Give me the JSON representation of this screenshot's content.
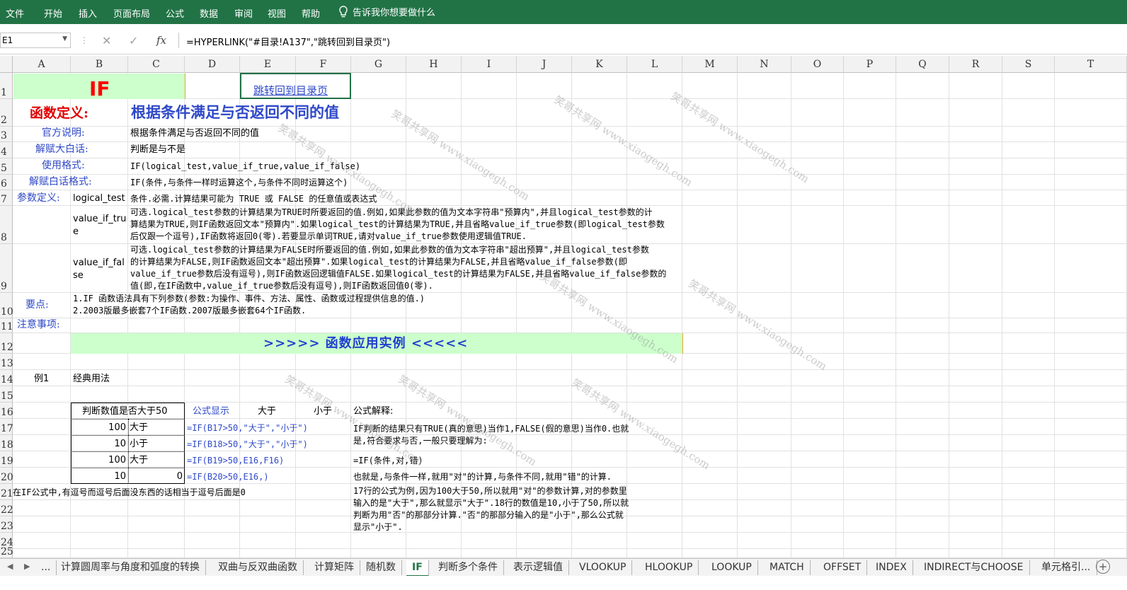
{
  "ribbon": {
    "tabs": [
      "文件",
      "开始",
      "插入",
      "页面布局",
      "公式",
      "数据",
      "审阅",
      "视图",
      "帮助"
    ],
    "tell_me": "告诉我你想要做什么"
  },
  "formula_bar": {
    "name_box": "E1",
    "formula": "=HYPERLINK(\"#目录!A137\",\"跳转回到目录页\")",
    "fx": "fx"
  },
  "columns": [
    "A",
    "B",
    "C",
    "D",
    "E",
    "F",
    "G",
    "H",
    "I",
    "J",
    "K",
    "L",
    "M",
    "N",
    "O",
    "P",
    "Q",
    "R",
    "S",
    "T"
  ],
  "rows": [
    "1",
    "2",
    "3",
    "4",
    "5",
    "6",
    "7",
    "8",
    "9",
    "10",
    "11",
    "12",
    "13",
    "14",
    "15",
    "16",
    "17",
    "18",
    "19",
    "20",
    "21",
    "22",
    "23",
    "24",
    "25"
  ],
  "cells": {
    "b1": "IF",
    "e1": "跳转回到目录页",
    "a2": "函数定义:",
    "c2": "根据条件满足与否返回不同的值",
    "a3": "官方说明:",
    "c3": "根据条件满足与否返回不同的值",
    "a4": "解赋大白话:",
    "c4": "判断是与不是",
    "a5": "使用格式:",
    "c5": "IF(logical_test,value_if_true,value_if_false)",
    "a6": "解赋白话格式:",
    "c6": "IF(条件,与条件一样时运算这个,与条件不同时运算这个)",
    "a7": "参数定义:",
    "b7": "logical_test",
    "c7": "条件.必需.计算结果可能为 TRUE 或 FALSE 的任意值或表达式",
    "b8a": "value_if_tru",
    "b8b": "e",
    "c8a": "可选.logical_test参数的计算结果为TRUE时所要返回的值.例如,如果此参数的值为文本字符串\"预算内\",并且logical_test参数的计",
    "c8b": "算结果为TRUE,则IF函数返回文本\"预算内\".如果logical_test的计算结果为TRUE,并且省略value_if_true参数(即logical_test参数",
    "c8c": "后仅跟一个逗号),IF函数将返回0(零).若要显示单词TRUE,请对value_if_true参数使用逻辑值TRUE.",
    "b9a": "value_if_fal",
    "b9b": "se",
    "c9a": "可选.logical_test参数的计算结果为FALSE时所要返回的值.例如,如果此参数的值为文本字符串\"超出预算\",并且logical_test参数",
    "c9b": "的计算结果为FALSE,则IF函数返回文本\"超出预算\".如果logical_test的计算结果为FALSE,并且省略value_if_false参数(即",
    "c9c": "value_if_true参数后没有逗号),则IF函数返回逻辑值FALSE.如果logical_test的计算结果为FALSE,并且省略value_if_false参数的",
    "c9d": "值(即,在IF函数中,value_if_true参数后没有逗号),则IF函数返回值0(零).",
    "a10": "要点:",
    "b10a": "1.IF 函数语法具有下列参数(参数:为操作、事件、方法、属性、函数或过程提供信息的值.)",
    "b10b": "2.2003版最多嵌套7个IF函数.2007版最多嵌套64个IF函数.",
    "a11": "注意事项:",
    "banner12": ">>>>>   函数应用实例   <<<<<",
    "a14": "例1",
    "b14": "经典用法",
    "b16": "判断数值是否大于50",
    "d16": "公式显示",
    "e16": "大于",
    "f16": "小于",
    "g16": "公式解释:",
    "table": [
      {
        "b": "100",
        "c": "大于",
        "d": "=IF(B17>50,\"大于\",\"小于\")"
      },
      {
        "b": "10",
        "c": "小于",
        "d": "=IF(B18>50,\"大于\",\"小于\")"
      },
      {
        "b": "100",
        "c": "大于",
        "d": "=IF(B19>50,E16,F16)"
      },
      {
        "b": "10",
        "c": "0",
        "d": "=IF(B20>50,E16,)"
      }
    ],
    "g17a": "IF判断的结果只有TRUE(真的意思)当作1,FALSE(假的意思)当作0.也就",
    "g17b": "是,符合要求与否,一般只要理解为:",
    "g19": "=IF(条件,对,错)",
    "g20": "也就是,与条件一样,就用\"对\"的计算,与条件不同,就用\"错\"的计算.",
    "a21": "在IF公式中,有逗号而逗号后面没东西的话相当于逗号后面是0",
    "g21a": "17行的公式为例,因为100大于50,所以就用\"对\"的参数计算,对的参数里",
    "g21b": "输入的是\"大于\",那么就显示\"大于\".18行的数值是10,小于了50,所以就",
    "g21c": "判断为用\"否\"的那部分计算.\"否\"的那部分输入的是\"小于\",那么公式就",
    "g21d": "显示\"小于\"."
  },
  "watermark": "笑哥共享网 www.xiaogegh.com",
  "sheet_tabs": [
    "...",
    "计算圆周率与角度和弧度的转换",
    "双曲与反双曲函数",
    "计算矩阵",
    "随机数",
    "IF",
    "判断多个条件",
    "表示逻辑值",
    "VLOOKUP",
    "HLOOKUP",
    "LOOKUP",
    "MATCH",
    "OFFSET",
    "INDEX",
    "INDIRECT与CHOOSE",
    "单元格引..."
  ],
  "colors": {
    "ribbon": "#217346",
    "accent_blue": "#2e48c8",
    "title_red": "#e00000",
    "banner_fill": "#ccffcc"
  }
}
